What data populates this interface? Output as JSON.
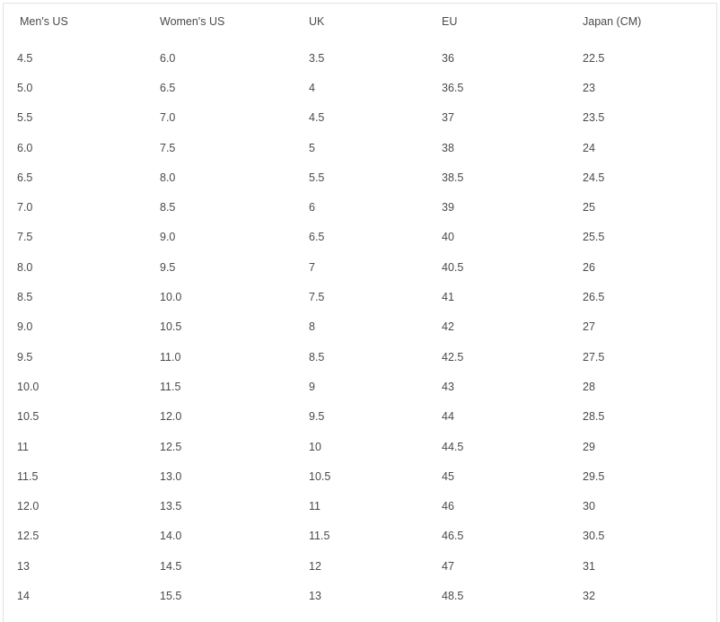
{
  "table": {
    "headers": [
      "Men's US",
      "Women's US",
      "UK",
      "EU",
      "Japan (CM)"
    ],
    "rows": [
      [
        "4.5",
        "6.0",
        "3.5",
        "36",
        "22.5"
      ],
      [
        "5.0",
        "6.5",
        "4",
        "36.5",
        "23"
      ],
      [
        "5.5",
        "7.0",
        "4.5",
        "37",
        "23.5"
      ],
      [
        "6.0",
        "7.5",
        "5",
        "38",
        "24"
      ],
      [
        "6.5",
        "8.0",
        "5.5",
        "38.5",
        "24.5"
      ],
      [
        "7.0",
        "8.5",
        "6",
        "39",
        "25"
      ],
      [
        "7.5",
        "9.0",
        "6.5",
        "40",
        "25.5"
      ],
      [
        "8.0",
        "9.5",
        "7",
        "40.5",
        "26"
      ],
      [
        "8.5",
        "10.0",
        "7.5",
        "41",
        "26.5"
      ],
      [
        "9.0",
        "10.5",
        "8",
        "42",
        "27"
      ],
      [
        "9.5",
        "11.0",
        "8.5",
        "42.5",
        "27.5"
      ],
      [
        "10.0",
        "11.5",
        "9",
        "43",
        "28"
      ],
      [
        "10.5",
        "12.0",
        "9.5",
        "44",
        "28.5"
      ],
      [
        "11",
        "12.5",
        "10",
        "44.5",
        "29"
      ],
      [
        "11.5",
        "13.0",
        "10.5",
        "45",
        "29.5"
      ],
      [
        "12.0",
        "13.5",
        "11",
        "46",
        "30"
      ],
      [
        "12.5",
        "14.0",
        "11.5",
        "46.5",
        "30.5"
      ],
      [
        "13",
        "14.5",
        "12",
        "47",
        "31"
      ],
      [
        "14",
        "15.5",
        "13",
        "48.5",
        "32"
      ]
    ]
  },
  "colors": {
    "text": "#4a4a4a",
    "border": "#e2e2e2"
  }
}
